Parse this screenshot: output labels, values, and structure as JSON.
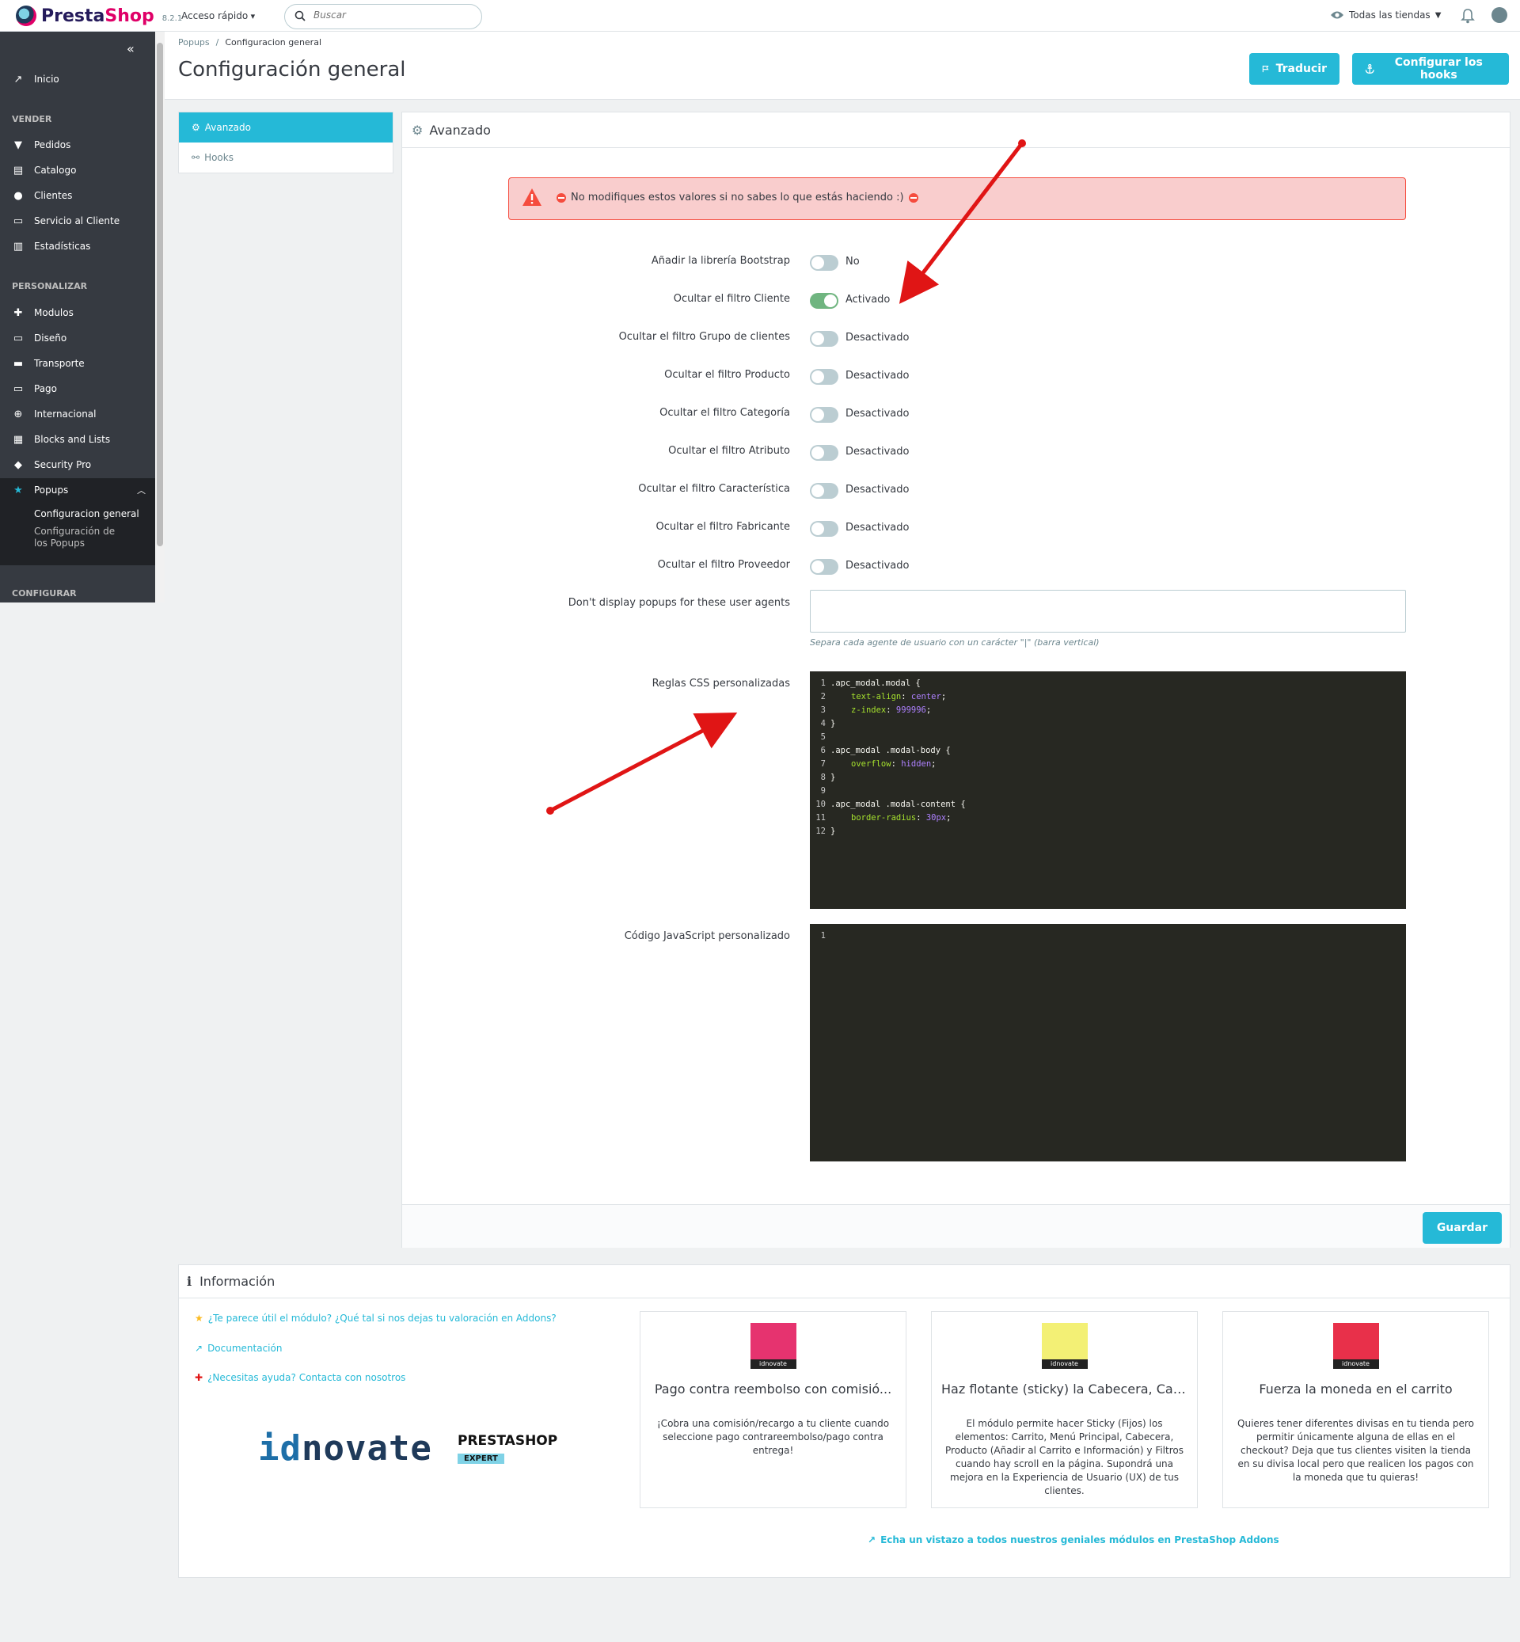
{
  "header": {
    "brand_part1": "Presta",
    "brand_part2": "Shop",
    "version": "8.2.1",
    "quick_access": "Acceso rápido",
    "search_placeholder": "Buscar",
    "stores": "Todas las tiendas"
  },
  "sidebar": {
    "home": "Inicio",
    "section_sell": "VENDER",
    "sell_items": [
      "Pedidos",
      "Catalogo",
      "Clientes",
      "Servicio al Cliente",
      "Estadísticas"
    ],
    "section_customize": "PERSONALIZAR",
    "customize_items": [
      "Modulos",
      "Diseño",
      "Transporte",
      "Pago",
      "Internacional",
      "Blocks and Lists",
      "Security Pro"
    ],
    "popups": "Popups",
    "popups_sub": [
      "Configuracion general",
      "Configuración de los Popups"
    ],
    "section_configure": "CONFIGURAR"
  },
  "page": {
    "breadcrumb_parent": "Popups",
    "breadcrumb_current": "Configuracion general",
    "title": "Configuración general",
    "translate_button": "Traducir",
    "hooks_button": "Configurar los hooks"
  },
  "tabs": [
    "Avanzado",
    "Hooks"
  ],
  "panel": {
    "title": "Avanzado",
    "alert": "No modifiques estos valores si no sabes lo que estás haciendo :)",
    "toggles": [
      {
        "label": "Añadir la librería Bootstrap",
        "on": false,
        "status": "No"
      },
      {
        "label": "Ocultar el filtro Cliente",
        "on": true,
        "status": "Activado"
      },
      {
        "label": "Ocultar el filtro Grupo de clientes",
        "on": false,
        "status": "Desactivado"
      },
      {
        "label": "Ocultar el filtro Producto",
        "on": false,
        "status": "Desactivado"
      },
      {
        "label": "Ocultar el filtro Categoría",
        "on": false,
        "status": "Desactivado"
      },
      {
        "label": "Ocultar el filtro Atributo",
        "on": false,
        "status": "Desactivado"
      },
      {
        "label": "Ocultar el filtro Característica",
        "on": false,
        "status": "Desactivado"
      },
      {
        "label": "Ocultar el filtro Fabricante",
        "on": false,
        "status": "Desactivado"
      },
      {
        "label": "Ocultar el filtro Proveedor",
        "on": false,
        "status": "Desactivado"
      }
    ],
    "user_agents_label": "Don't display popups for these user agents",
    "user_agents_value": "",
    "user_agents_help": "Separa cada agente de usuario con un carácter \"|\" (barra vertical)",
    "css_label": "Reglas CSS personalizadas",
    "js_label": "Código JavaScript personalizado",
    "js_line": "1",
    "save_button": "Guardar"
  },
  "css_code": [
    [
      "1",
      ".apc_modal.modal {",
      "",
      ""
    ],
    [
      "2",
      "",
      "text-align",
      "center"
    ],
    [
      "3",
      "",
      "z-index",
      "999996"
    ],
    [
      "4",
      "}",
      "",
      ""
    ],
    [
      "5",
      "",
      "",
      ""
    ],
    [
      "6",
      ".apc_modal .modal-body {",
      "",
      ""
    ],
    [
      "7",
      "",
      "overflow",
      "hidden"
    ],
    [
      "8",
      "}",
      "",
      ""
    ],
    [
      "9",
      "",
      "",
      ""
    ],
    [
      "10",
      ".apc_modal .modal-content {",
      "",
      ""
    ],
    [
      "11",
      "",
      "border-radius",
      "30px"
    ],
    [
      "12",
      "}",
      "",
      ""
    ]
  ],
  "info": {
    "title": "Información",
    "links": [
      "¿Te parece útil el módulo? ¿Qué tal si nos dejas tu valoración en Addons?",
      "Documentación",
      "¿Necesitas ayuda? Contacta con nosotros"
    ],
    "logo_id": "id",
    "logo_rest": "novate",
    "expert_title": "PRESTASHOP",
    "expert_badge": "EXPERT",
    "cards": [
      {
        "title": "Pago contra reembolso con comisió...",
        "desc": "¡Cobra una comisión/recargo a tu cliente cuando seleccione pago contrareembolso/pago contra entrega!",
        "color": "#e6336f"
      },
      {
        "title": "Haz flotante (sticky) la Cabecera, Carr...",
        "desc": "El módulo permite hacer Sticky (Fijos) los elementos: Carrito, Menú Principal, Cabecera, Producto (Añadir al Carrito e Información) y Filtros cuando hay scroll en la página. Supondrá una mejora en la Experiencia de Usuario (UX) de tus clientes.",
        "color": "#f3f075"
      },
      {
        "title": "Fuerza la moneda en el carrito",
        "desc": "Quieres tener diferentes divisas en tu tienda pero permitir únicamente alguna de ellas en el checkout? Deja que tus clientes visiten la tienda en su divisa local pero que realicen los pagos con la moneda que tu quieras!",
        "color": "#e8304a"
      }
    ],
    "card_brand": "idnovate",
    "more_link": "Echa un vistazo a todos nuestros geniales módulos en PrestaShop Addons"
  },
  "colors": {
    "accent": "#25b9d7",
    "sidebar": "#363a41",
    "toggle_on": "#70b580",
    "alert_bg": "#f9cdcd",
    "arrow": "#e01515"
  }
}
